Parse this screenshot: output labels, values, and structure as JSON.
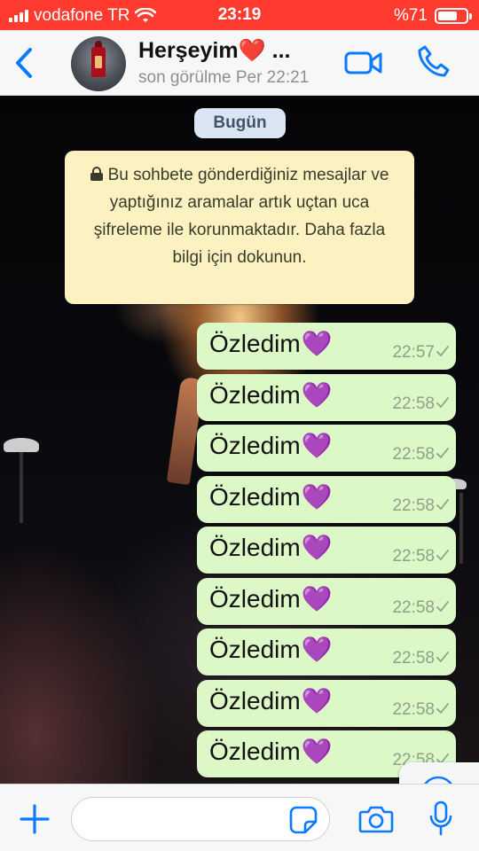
{
  "status_bar": {
    "carrier": "vodafone TR",
    "time": "23:19",
    "battery_text": "%71",
    "battery_level": 0.71
  },
  "header": {
    "contact_name": "Herşeyim❤️ ...",
    "last_seen": "son görülme Per 22:21",
    "icons": [
      "chevron-left-icon",
      "video-camera-icon",
      "phone-icon"
    ]
  },
  "chat": {
    "date_label": "Bugün",
    "encryption_notice": "Bu sohbete gönderdiğiniz mesajlar ve yaptığınız aramalar artık uçtan uca şifreleme ile korunmaktadır. Daha fazla bilgi için dokunun.",
    "messages": [
      {
        "text": "Özledim",
        "emoji": "💜",
        "time": "22:57"
      },
      {
        "text": "Özledim",
        "emoji": "💜",
        "time": "22:58"
      },
      {
        "text": "Özledim",
        "emoji": "💜",
        "time": "22:58"
      },
      {
        "text": "Özledim",
        "emoji": "💜",
        "time": "22:58"
      },
      {
        "text": "Özledim",
        "emoji": "💜",
        "time": "22:58"
      },
      {
        "text": "Özledim",
        "emoji": "💜",
        "time": "22:58"
      },
      {
        "text": "Özledim",
        "emoji": "💜",
        "time": "22:58"
      },
      {
        "text": "Özledim",
        "emoji": "💜",
        "time": "22:58"
      },
      {
        "text": "Özledim",
        "emoji": "💜",
        "time": "22:58"
      }
    ]
  },
  "input_bar": {
    "placeholder": "",
    "icons": [
      "plus-icon",
      "sticker-icon",
      "camera-icon",
      "microphone-icon"
    ]
  },
  "colors": {
    "accent": "#0a7aff",
    "status_bar_bg": "#ff3b30",
    "outgoing_bubble": "#dcf8c6",
    "notice_bg": "#fbf1c1",
    "date_chip_bg": "#dbe6f5",
    "heart": "#9b30e0"
  }
}
